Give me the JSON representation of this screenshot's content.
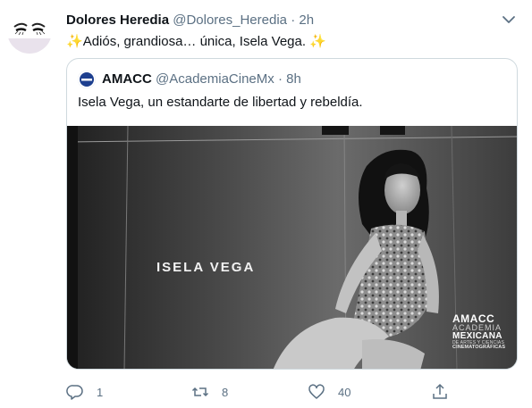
{
  "tweet": {
    "author_name": "Dolores Heredia",
    "author_handle": "@Dolores_Heredia",
    "separator": "·",
    "time": "2h",
    "text_prefix": "✨",
    "text_body": "Adiós, grandiosa… única, Isela Vega.",
    "text_suffix": "✨",
    "avatar_icon": "face-sketch-avatar",
    "more_icon": "chevron-down-icon"
  },
  "quoted": {
    "author_name": "AMACC",
    "author_handle": "@AcademiaCineMx",
    "separator": "·",
    "time": "8h",
    "text": "Isela Vega, un estandarte de libertad y rebeldía.",
    "media_caption": "ISELA VEGA",
    "logo": {
      "line1": "AMACC",
      "line2": "ACADEMIA",
      "line3": "MEXICANA",
      "line4": "DE ARTES Y CIENCIAS",
      "line5": "CINEMATOGRÁFICAS"
    }
  },
  "actions": {
    "reply_count": "1",
    "retweet_count": "8",
    "like_count": "40",
    "share_count": ""
  },
  "colors": {
    "text_primary": "#0f1419",
    "text_secondary": "#5b7083",
    "border": "#cfd9de",
    "sparkle": "#f4c331"
  }
}
